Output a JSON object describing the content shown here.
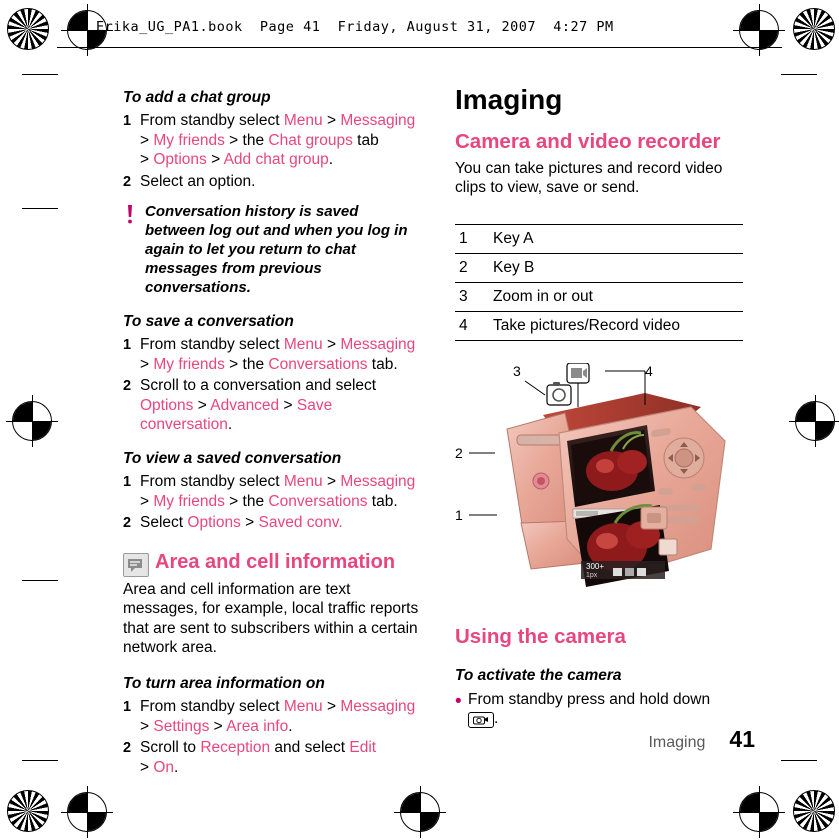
{
  "header": {
    "text": "Erika_UG_PA1.book  Page 41  Friday, August 31, 2007  4:27 PM"
  },
  "left_column": {
    "sections": [
      {
        "heading": "To add a chat group",
        "steps": [
          {
            "num": "1",
            "parts": [
              {
                "t": "From standby select ",
                "c": "black"
              },
              {
                "t": "Menu",
                "c": "pink"
              },
              {
                "t": " > ",
                "c": "black"
              },
              {
                "t": "Messaging",
                "c": "pink"
              },
              {
                "t": " > ",
                "c": "black"
              },
              {
                "t": "My friends",
                "c": "pink"
              },
              {
                "t": " > the ",
                "c": "black"
              },
              {
                "t": "Chat groups",
                "c": "pink"
              },
              {
                "t": " tab > ",
                "c": "black"
              },
              {
                "t": "Options",
                "c": "pink"
              },
              {
                "t": " > ",
                "c": "black"
              },
              {
                "t": "Add chat group",
                "c": "pink"
              },
              {
                "t": ".",
                "c": "black"
              }
            ]
          },
          {
            "num": "2",
            "parts": [
              {
                "t": "Select an option.",
                "c": "black"
              }
            ]
          }
        ]
      }
    ],
    "note": "Conversation history is saved between log out and when you log in again to let you return to chat messages from previous conversations.",
    "note_icon": "exclamation-icon",
    "sections2": [
      {
        "heading": "To save a conversation",
        "steps": [
          {
            "num": "1",
            "parts": [
              {
                "t": "From standby select ",
                "c": "black"
              },
              {
                "t": "Menu",
                "c": "pink"
              },
              {
                "t": " > ",
                "c": "black"
              },
              {
                "t": "Messaging",
                "c": "pink"
              },
              {
                "t": " > ",
                "c": "black"
              },
              {
                "t": "My friends",
                "c": "pink"
              },
              {
                "t": " > the ",
                "c": "black"
              },
              {
                "t": "Conversations",
                "c": "pink"
              },
              {
                "t": " tab.",
                "c": "black"
              }
            ]
          },
          {
            "num": "2",
            "parts": [
              {
                "t": "Scroll to a conversation and select ",
                "c": "black"
              },
              {
                "t": "Options",
                "c": "pink"
              },
              {
                "t": " > ",
                "c": "black"
              },
              {
                "t": "Advanced",
                "c": "pink"
              },
              {
                "t": " > ",
                "c": "black"
              },
              {
                "t": "Save conversation",
                "c": "pink"
              },
              {
                "t": ".",
                "c": "black"
              }
            ]
          }
        ]
      },
      {
        "heading": "To view a saved conversation",
        "steps": [
          {
            "num": "1",
            "parts": [
              {
                "t": "From standby select ",
                "c": "black"
              },
              {
                "t": "Menu",
                "c": "pink"
              },
              {
                "t": " > ",
                "c": "black"
              },
              {
                "t": "Messaging",
                "c": "pink"
              },
              {
                "t": " > ",
                "c": "black"
              },
              {
                "t": "My friends",
                "c": "pink"
              },
              {
                "t": " > the ",
                "c": "black"
              },
              {
                "t": "Conversations",
                "c": "pink"
              },
              {
                "t": " tab.",
                "c": "black"
              }
            ]
          },
          {
            "num": "2",
            "parts": [
              {
                "t": "Select ",
                "c": "black"
              },
              {
                "t": "Options",
                "c": "pink"
              },
              {
                "t": " > ",
                "c": "black"
              },
              {
                "t": "Saved conv.",
                "c": "pink"
              }
            ]
          }
        ]
      }
    ],
    "area_section": {
      "heading": "Area and cell information",
      "badge_icon": "area-info-icon",
      "body": "Area and cell information are text messages, for example, local traffic reports that are sent to subscribers within a certain network area.",
      "sub_heading": "To turn area information on",
      "steps": [
        {
          "num": "1",
          "parts": [
            {
              "t": "From standby select ",
              "c": "black"
            },
            {
              "t": "Menu",
              "c": "pink"
            },
            {
              "t": " > ",
              "c": "black"
            },
            {
              "t": "Messaging",
              "c": "pink"
            },
            {
              "t": " > ",
              "c": "black"
            },
            {
              "t": "Settings",
              "c": "pink"
            },
            {
              "t": " > ",
              "c": "black"
            },
            {
              "t": "Area info",
              "c": "pink"
            },
            {
              "t": ".",
              "c": "black"
            }
          ]
        },
        {
          "num": "2",
          "parts": [
            {
              "t": "Scroll to ",
              "c": "black"
            },
            {
              "t": "Reception",
              "c": "pink"
            },
            {
              "t": " and select ",
              "c": "black"
            },
            {
              "t": "Edit",
              "c": "pink"
            },
            {
              "t": " > ",
              "c": "black"
            },
            {
              "t": "On",
              "c": "pink"
            },
            {
              "t": ".",
              "c": "black"
            }
          ]
        }
      ]
    }
  },
  "right_column": {
    "chapter_title": "Imaging",
    "section_title": "Camera and video recorder",
    "intro": "You can take pictures and record video clips to view, save or send.",
    "key_table": {
      "rows": [
        {
          "num": "1",
          "desc": "Key A"
        },
        {
          "num": "2",
          "desc": "Key B"
        },
        {
          "num": "3",
          "desc": "Zoom in or out"
        },
        {
          "num": "4",
          "desc": "Take pictures/Record video"
        }
      ]
    },
    "illustration": {
      "name": "phone-camera-illustration",
      "callouts": [
        "1",
        "2",
        "3",
        "4"
      ],
      "screen_labels": [
        "300+",
        "1px"
      ],
      "icons": [
        "camera-icon",
        "video-camera-icon"
      ]
    },
    "using_camera_title": "Using the camera",
    "activate_heading": "To activate the camera",
    "activate_text": "From standby press and hold down",
    "activate_key_icon": "camera-key-icon",
    "activate_period": "."
  },
  "footer": {
    "label": "Imaging",
    "page": "41"
  }
}
